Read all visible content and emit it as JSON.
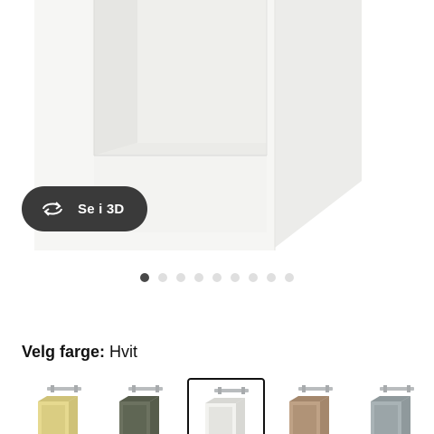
{
  "gallery": {
    "view3d_label": "Se i 3D",
    "dot_count": 9,
    "active_index": 0
  },
  "color_selector": {
    "label": "Velg farge:",
    "selected": "Hvit",
    "options": [
      {
        "color": "#e6d98f",
        "shade": "#cfc278"
      },
      {
        "color": "#6c7260",
        "shade": "#565c4b"
      },
      {
        "color": "#f2f2ef",
        "shade": "#d8d8d4",
        "selected": true
      },
      {
        "color": "#bfa286",
        "shade": "#a4876c"
      },
      {
        "color": "#a9b3b6",
        "shade": "#8f999c"
      }
    ]
  },
  "colors": {
    "product": "#f4f4f2",
    "button_bg": "#3a3a3a",
    "dot_active": "#484848",
    "dot_inactive": "#dfdfdf"
  }
}
